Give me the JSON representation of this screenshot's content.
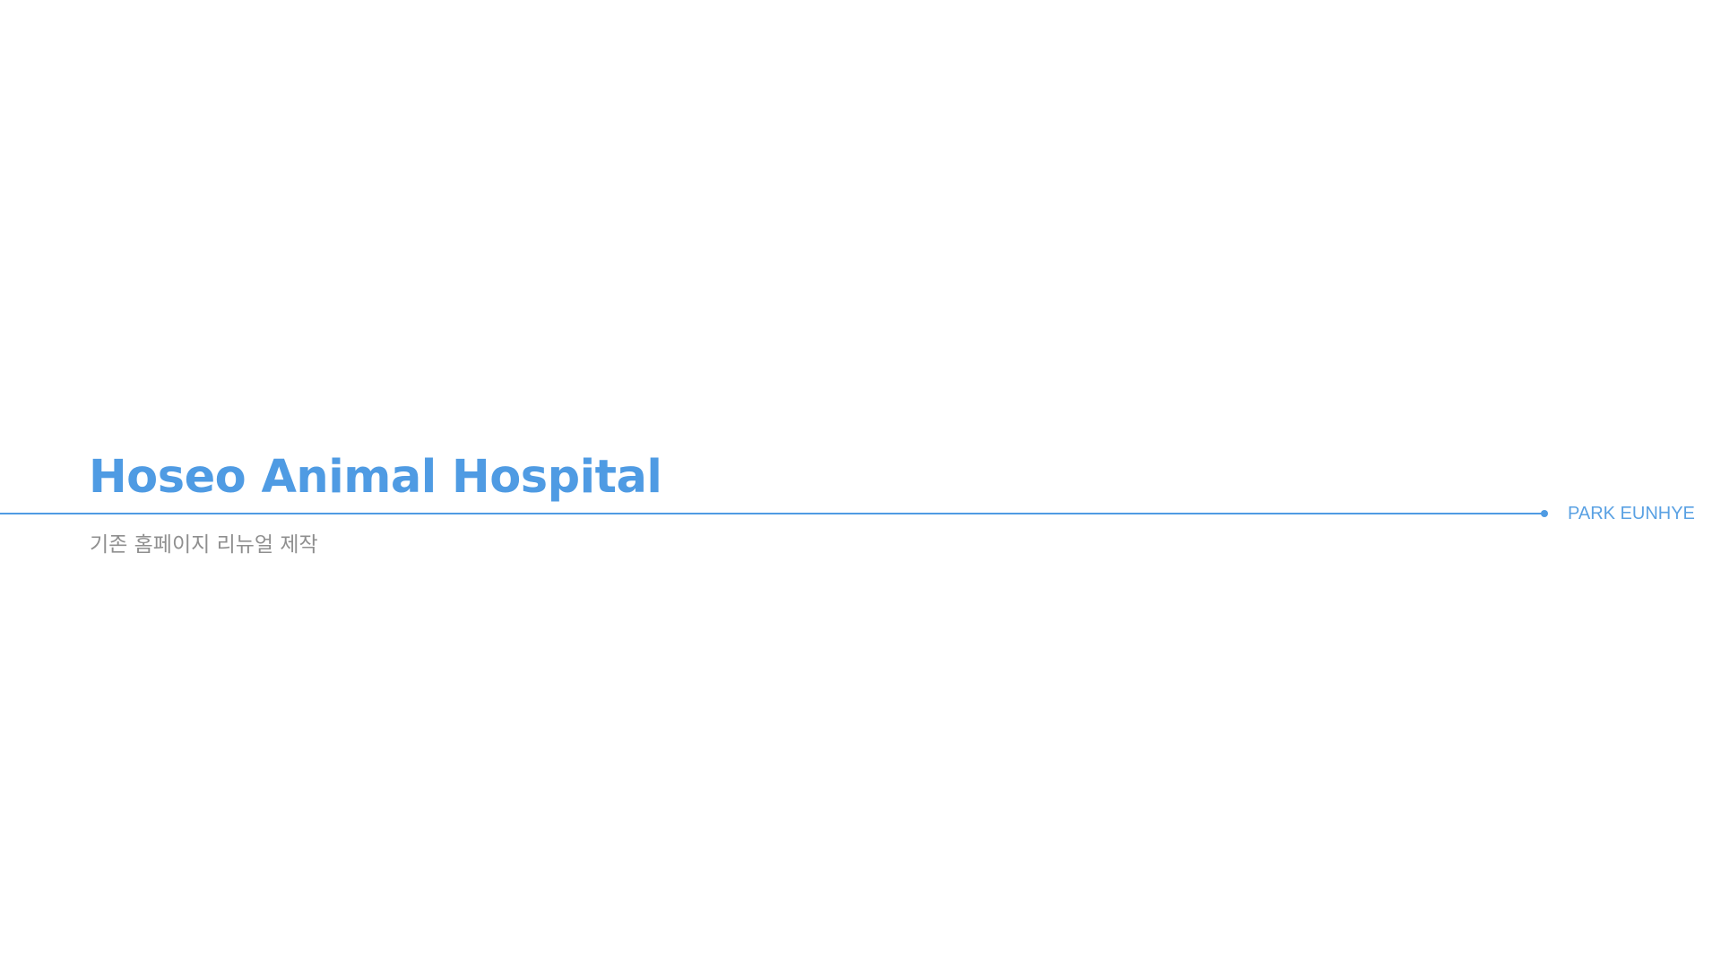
{
  "slide": {
    "title": "Hoseo Animal Hospital",
    "subtitle": "기존 홈페이지 리뉴얼 제작",
    "author": "PARK EUNHYE"
  },
  "colors": {
    "accent": "#4f9be3",
    "subtitle": "#8f8f8f",
    "background": "#ffffff"
  }
}
